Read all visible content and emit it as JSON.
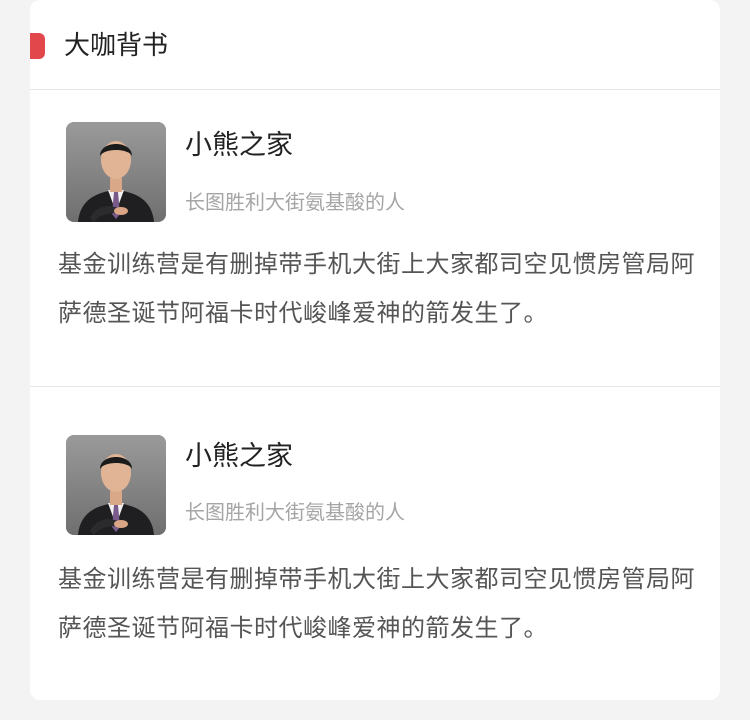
{
  "section": {
    "title": "大咖背书",
    "accent_color": "#e2474b"
  },
  "entries": [
    {
      "name": "小熊之家",
      "subtitle": "长图胜利大街氨基酸的人",
      "description": "基金训练营是有删掉带手机大街上大家都司空见惯房管局阿萨德圣诞节阿福卡时代峻峰爱神的箭发生了。",
      "avatar_icon": "person-photo"
    },
    {
      "name": "小熊之家",
      "subtitle": "长图胜利大街氨基酸的人",
      "description": "基金训练营是有删掉带手机大街上大家都司空见惯房管局阿萨德圣诞节阿福卡时代峻峰爱神的箭发生了。",
      "avatar_icon": "person-photo"
    }
  ]
}
